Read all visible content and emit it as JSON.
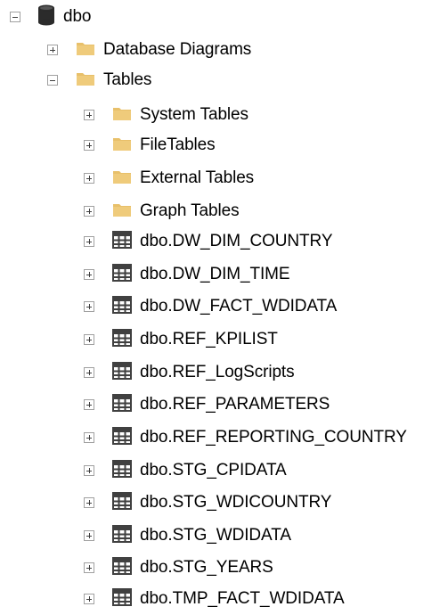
{
  "tree": {
    "root": {
      "label": "dbo",
      "icon": "database-icon",
      "expanded": true
    },
    "children": [
      {
        "label": "Database Diagrams",
        "icon": "folder-icon",
        "expanded": false
      },
      {
        "label": "Tables",
        "icon": "folder-icon",
        "expanded": true
      }
    ],
    "tables_children": [
      {
        "label": "System Tables",
        "icon": "folder-icon",
        "expanded": false
      },
      {
        "label": "FileTables",
        "icon": "folder-icon",
        "expanded": false
      },
      {
        "label": "External Tables",
        "icon": "folder-icon",
        "expanded": false
      },
      {
        "label": "Graph Tables",
        "icon": "folder-icon",
        "expanded": false
      },
      {
        "label": "dbo.DW_DIM_COUNTRY",
        "icon": "table-icon",
        "expanded": false
      },
      {
        "label": "dbo.DW_DIM_TIME",
        "icon": "table-icon",
        "expanded": false
      },
      {
        "label": "dbo.DW_FACT_WDIDATA",
        "icon": "table-icon",
        "expanded": false
      },
      {
        "label": "dbo.REF_KPILIST",
        "icon": "table-icon",
        "expanded": false
      },
      {
        "label": "dbo.REF_LogScripts",
        "icon": "table-icon",
        "expanded": false
      },
      {
        "label": "dbo.REF_PARAMETERS",
        "icon": "table-icon",
        "expanded": false
      },
      {
        "label": "dbo.REF_REPORTING_COUNTRY",
        "icon": "table-icon",
        "expanded": false
      },
      {
        "label": "dbo.STG_CPIDATA",
        "icon": "table-icon",
        "expanded": false
      },
      {
        "label": "dbo.STG_WDICOUNTRY",
        "icon": "table-icon",
        "expanded": false
      },
      {
        "label": "dbo.STG_WDIDATA",
        "icon": "table-icon",
        "expanded": false
      },
      {
        "label": "dbo.STG_YEARS",
        "icon": "table-icon",
        "expanded": false
      },
      {
        "label": "dbo.TMP_FACT_WDIDATA",
        "icon": "table-icon",
        "expanded": false
      }
    ]
  },
  "colors": {
    "folder": "#e8c06a",
    "folder_dark": "#d9a83f",
    "database": "#2b2b2b",
    "table_grid": "#404040"
  }
}
